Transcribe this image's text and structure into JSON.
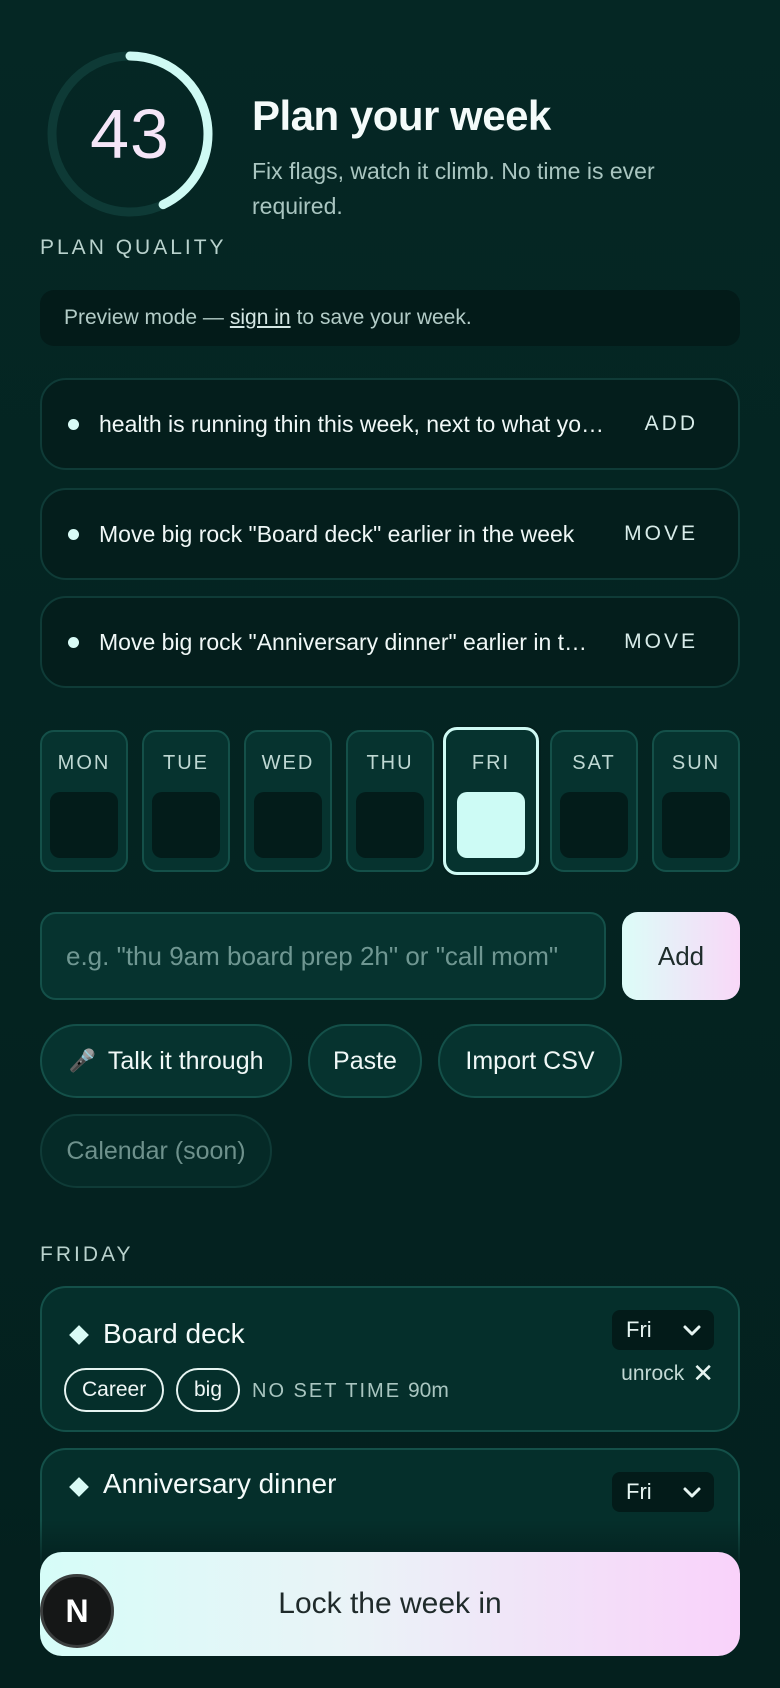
{
  "header": {
    "score": "43",
    "score_label": "PLAN QUALITY",
    "score_fraction": 0.43,
    "title": "Plan your week",
    "subtitle": "Fix flags, watch it climb. No time is ever required."
  },
  "preview": {
    "prefix": "Preview mode —",
    "link": "sign in",
    "suffix": "to save your week."
  },
  "flags": [
    {
      "text": "health is running thin this week, next to what you usually plan",
      "action": "ADD"
    },
    {
      "text": "Move big rock \"Board deck\" earlier in the week",
      "action": "MOVE"
    },
    {
      "text": "Move big rock \"Anniversary dinner\" earlier in the week",
      "action": "MOVE"
    }
  ],
  "days": [
    {
      "label": "MON"
    },
    {
      "label": "TUE"
    },
    {
      "label": "WED"
    },
    {
      "label": "THU"
    },
    {
      "label": "FRI",
      "active": true
    },
    {
      "label": "SAT"
    },
    {
      "label": "SUN"
    }
  ],
  "composer": {
    "placeholder": "e.g. \"thu 9am board prep 2h\" or \"call mom\"",
    "add_label": "Add"
  },
  "actions": {
    "talk": "Talk it through",
    "talk_icon": "microphone-icon",
    "paste": "Paste",
    "import": "Import CSV",
    "calendar": "Calendar (soon)"
  },
  "section": {
    "label": "FRIDAY"
  },
  "tasks": [
    {
      "title": "Board deck",
      "day": "Fri",
      "tags": [
        "Career",
        "big"
      ],
      "time": "NO SET TIME",
      "duration": "90m",
      "unrock": "unrock"
    },
    {
      "title": "Anniversary dinner",
      "day": "Fri"
    }
  ],
  "footer": {
    "lock_label": "Lock the week in",
    "avatar_letter": "N"
  },
  "colors": {
    "background": "#04201e",
    "accent_mint": "#cffaf4",
    "accent_pink": "#f9d2fa"
  }
}
